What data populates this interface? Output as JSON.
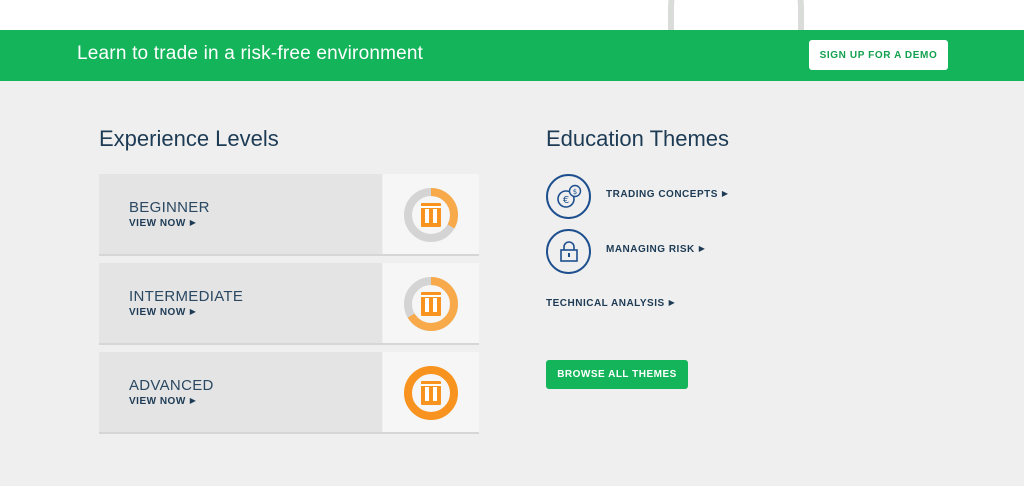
{
  "banner": {
    "text": "Learn to trade in a risk-free environment",
    "demo_button": "SIGN UP FOR A DEMO"
  },
  "experience": {
    "title": "Experience Levels",
    "levels": [
      {
        "name": "BEGINNER",
        "link": "VIEW NOW",
        "arrow": "▶",
        "progress": 0.33
      },
      {
        "name": "INTERMEDIATE",
        "link": "VIEW NOW",
        "arrow": "▶",
        "progress": 0.66
      },
      {
        "name": "ADVANCED",
        "link": "VIEW NOW",
        "arrow": "▶",
        "progress": 1.0
      }
    ]
  },
  "education": {
    "title": "Education Themes",
    "themes": [
      {
        "label": "TRADING CONCEPTS",
        "arrow": "▶",
        "icon": "currency-exchange-icon"
      },
      {
        "label": "MANAGING RISK",
        "arrow": "▶",
        "icon": "lock-icon"
      },
      {
        "label": "TECHNICAL ANALYSIS",
        "arrow": "▶",
        "icon": ""
      }
    ],
    "browse_button": "BROWSE ALL THEMES"
  },
  "colors": {
    "brand_green": "#13b45a",
    "navy": "#1d3b55",
    "orange": "#f7931e",
    "light_orange": "#f8a94a",
    "gray_track": "#d4d4d4"
  }
}
